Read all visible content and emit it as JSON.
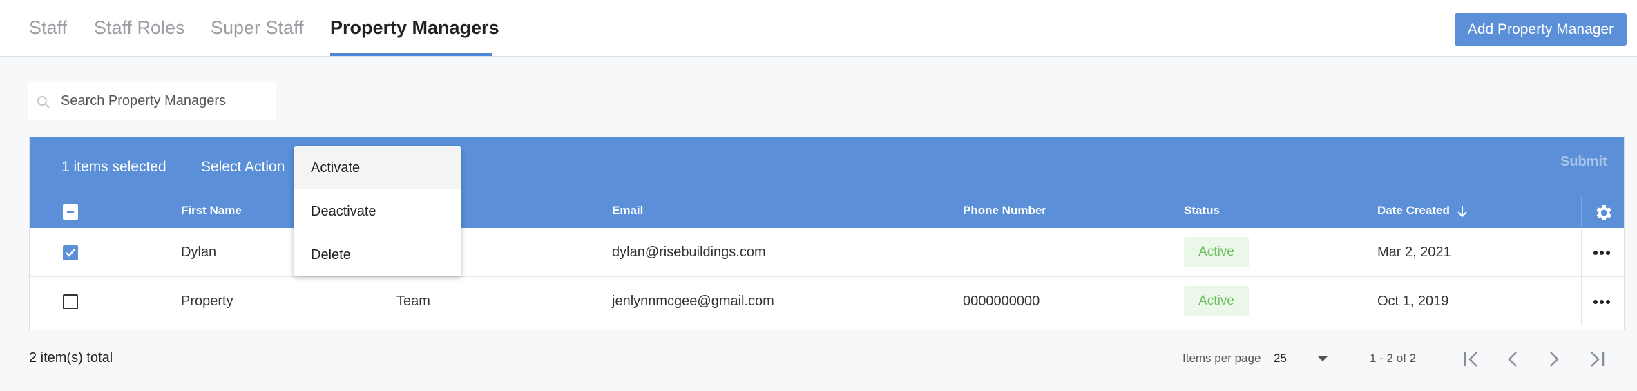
{
  "tabs": [
    {
      "label": "Staff",
      "active": false
    },
    {
      "label": "Staff Roles",
      "active": false
    },
    {
      "label": "Super Staff",
      "active": false
    },
    {
      "label": "Property Managers",
      "active": true
    }
  ],
  "add_button_label": "Add Property Manager",
  "search": {
    "placeholder": "Search Property Managers",
    "value": ""
  },
  "action_bar": {
    "selected_text": "1 items selected",
    "select_action_label": "Select Action",
    "submit_label": "Submit"
  },
  "action_menu": {
    "items": [
      "Activate",
      "Deactivate",
      "Delete"
    ],
    "highlighted": "Activate"
  },
  "table": {
    "columns": {
      "first_name": "First Name",
      "email": "Email",
      "phone": "Phone Number",
      "status": "Status",
      "date_created": "Date Created"
    },
    "sort": {
      "column": "Date Created",
      "direction": "descending"
    },
    "rows": [
      {
        "selected": true,
        "first_name": "Dylan",
        "last_name": "",
        "email": "dylan@risebuildings.com",
        "phone": "",
        "status": "Active",
        "date_created": "Mar 2, 2021"
      },
      {
        "selected": false,
        "first_name": "Property",
        "last_name": "Team",
        "email": "jenlynnmcgee@gmail.com",
        "phone": "0000000000",
        "status": "Active",
        "date_created": "Oct 1, 2019"
      }
    ]
  },
  "footer": {
    "total_text": "2 item(s) total",
    "items_per_page_label": "Items per page",
    "items_per_page_value": "25",
    "range_text": "1 - 2 of 2"
  },
  "colors": {
    "accent": "#5b90d8",
    "status_active_bg": "#ebf7e8",
    "status_active_text": "#6cbf5d"
  },
  "icons": [
    "search-icon",
    "sort-down-arrow-icon",
    "gear-icon",
    "more-horizontal-icon",
    "chevron-down-icon",
    "first-page-icon",
    "prev-page-icon",
    "next-page-icon",
    "last-page-icon"
  ]
}
